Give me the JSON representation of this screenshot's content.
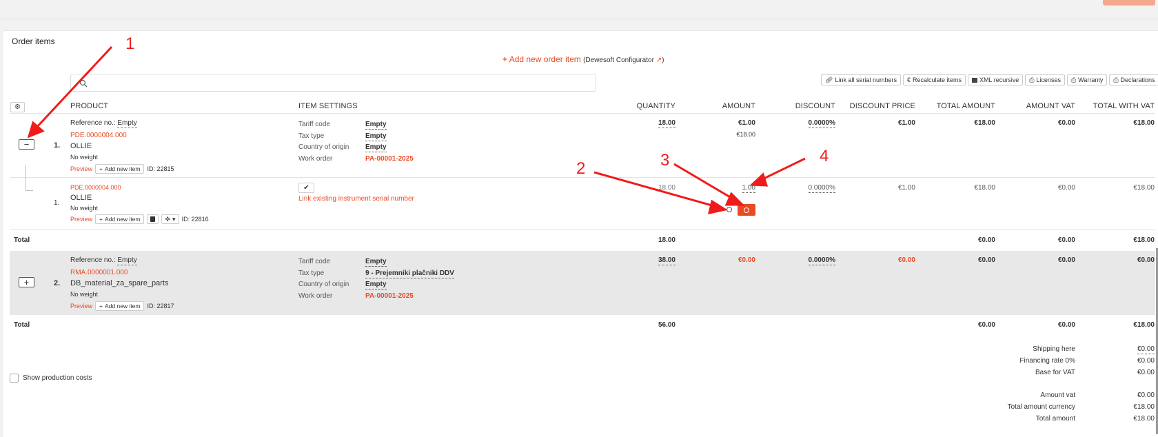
{
  "section_title": "Order items",
  "add_item": {
    "label": "Add new order item",
    "configurator": "(Dewesoft Configurator",
    "configurator_end": ")"
  },
  "search": {
    "placeholder": ""
  },
  "toolbar": [
    {
      "label": "Link all serial numbers",
      "icon": "link-icon"
    },
    {
      "label": "Recalculate items",
      "icon": "euro-icon"
    },
    {
      "label": "XML recursive",
      "icon": "archive-icon"
    },
    {
      "label": "Licenses",
      "icon": "print-icon"
    },
    {
      "label": "Warranty",
      "icon": "print-icon"
    },
    {
      "label": "Declarations",
      "icon": "print-icon"
    }
  ],
  "columns": {
    "product": "PRODUCT",
    "settings": "ITEM SETTINGS",
    "quantity": "QUANTITY",
    "amount": "AMOUNT",
    "discount": "DISCOUNT",
    "discount_price": "DISCOUNT PRICE",
    "total_amount": "TOTAL AMOUNT",
    "amount_vat": "AMOUNT VAT",
    "total_with_vat": "TOTAL WITH VAT"
  },
  "item1": {
    "collapse": "−",
    "num": "1.",
    "ref_label": "Reference no.:",
    "ref_value": "Empty",
    "code": "PDE.0000004.000",
    "name": "OLLIE",
    "weight": "No weight",
    "preview": "Preview",
    "add_new": "Add new item",
    "id": "ID: 22815",
    "settings": [
      {
        "label": "Tariff code",
        "value": "Empty"
      },
      {
        "label": "Tax type",
        "value": "Empty"
      },
      {
        "label": "Country of origin",
        "value": "Empty"
      },
      {
        "label": "Work order",
        "value": "PA-00001-2025"
      }
    ],
    "quantity": "18.00",
    "amount": "€1.00",
    "amount_sub": "€18.00",
    "discount": "0.0000%",
    "discount_price": "€1.00",
    "total_amount": "€18.00",
    "amount_vat": "€0.00",
    "total_with_vat": "€18.00"
  },
  "sub1": {
    "num": "1.",
    "code": "PDE.0000004.000",
    "name": "OLLIE",
    "weight": "No weight",
    "preview": "Preview",
    "add_new": "Add new item",
    "id": "ID: 22816",
    "serial_link": "Link existing instrument serial number",
    "quantity": "18.00",
    "amount": "1.00",
    "discount": "0.0000%",
    "discount_price": "€1.00",
    "total_amount": "€18.00",
    "amount_vat": "€0.00",
    "total_with_vat": "€18.00"
  },
  "total1": {
    "label": "Total",
    "quantity": "18.00",
    "total_amount": "€0.00",
    "amount_vat": "€0.00",
    "total_with_vat": "€18.00"
  },
  "item2": {
    "expand": "+",
    "num": "2.",
    "ref_label": "Reference no.:",
    "ref_value": "Empty",
    "code": "RMA.0000001.000",
    "name": "DB_material_za_spare_parts",
    "weight": "No weight",
    "preview": "Preview",
    "add_new": "Add new item",
    "id": "ID: 22817",
    "settings": [
      {
        "label": "Tariff code",
        "value": "Empty"
      },
      {
        "label": "Tax type",
        "value": "9 - Prejemniki plačniki DDV"
      },
      {
        "label": "Country of origin",
        "value": "Empty"
      },
      {
        "label": "Work order",
        "value": "PA-00001-2025"
      }
    ],
    "quantity": "38.00",
    "amount": "€0.00",
    "discount": "0.0000%",
    "discount_price": "€0.00",
    "total_amount": "€0.00",
    "amount_vat": "€0.00",
    "total_with_vat": "€0.00"
  },
  "total2": {
    "label": "Total",
    "quantity": "56.00",
    "total_amount": "€0.00",
    "amount_vat": "€0.00",
    "total_with_vat": "€18.00"
  },
  "show_production_costs": "Show production costs",
  "summary": [
    {
      "label": "Shipping here",
      "value": "€0.00"
    },
    {
      "label": "Financing rate 0%",
      "value": "€0.00"
    },
    {
      "label": "Base for VAT",
      "value": "€0.00"
    },
    {
      "label": "Amount vat",
      "value": "€0.00"
    },
    {
      "label": "Total amount currency",
      "value": "€18.00"
    },
    {
      "label": "Total amount",
      "value": "€18.00"
    }
  ],
  "annotations": [
    "1",
    "2",
    "3",
    "4"
  ],
  "colors": {
    "accent": "#e84b24",
    "arrow": "#f01b1b"
  }
}
